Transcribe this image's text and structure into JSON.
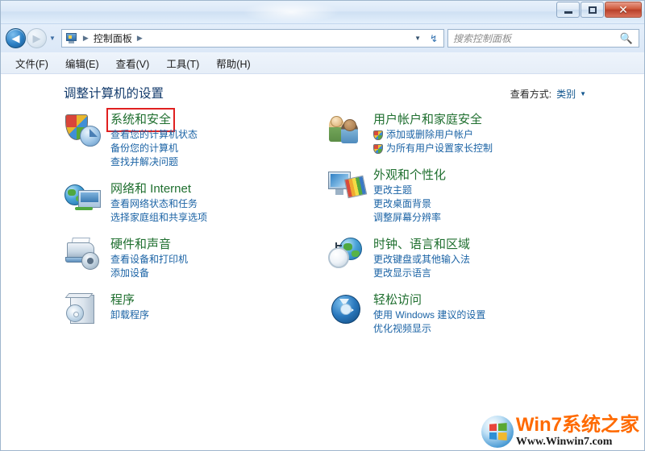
{
  "window": {
    "controls": {
      "minimize_label": "—",
      "maximize_label": "▫",
      "close_label": "✕"
    }
  },
  "addressbar": {
    "back_arrow": "◀",
    "forward_arrow": "▶",
    "history_caret": "▼",
    "breadcrumb_icon": "control-panel-icon",
    "breadcrumb": [
      "控制面板"
    ],
    "separator": "▶",
    "dropdown_caret": "▼",
    "refresh_glyph": "↯"
  },
  "search": {
    "placeholder": "搜索控制面板",
    "icon": "🔍"
  },
  "menubar": {
    "items": [
      {
        "label": "文件(F)"
      },
      {
        "label": "编辑(E)"
      },
      {
        "label": "查看(V)"
      },
      {
        "label": "工具(T)"
      },
      {
        "label": "帮助(H)"
      }
    ]
  },
  "page": {
    "title": "调整计算机的设置",
    "viewby_label": "查看方式:",
    "viewby_value": "类别",
    "viewby_caret": "▼"
  },
  "categories": {
    "left": [
      {
        "icon": "system-security-icon",
        "title": "系统和安全",
        "highlighted": true,
        "links": [
          {
            "label": "查看您的计算机状态",
            "shield": false
          },
          {
            "label": "备份您的计算机",
            "shield": false
          },
          {
            "label": "查找并解决问题",
            "shield": false
          }
        ]
      },
      {
        "icon": "network-internet-icon",
        "title": "网络和 Internet",
        "highlighted": false,
        "links": [
          {
            "label": "查看网络状态和任务",
            "shield": false
          },
          {
            "label": "选择家庭组和共享选项",
            "shield": false
          }
        ]
      },
      {
        "icon": "hardware-sound-icon",
        "title": "硬件和声音",
        "highlighted": false,
        "links": [
          {
            "label": "查看设备和打印机",
            "shield": false
          },
          {
            "label": "添加设备",
            "shield": false
          }
        ]
      },
      {
        "icon": "programs-icon",
        "title": "程序",
        "highlighted": false,
        "links": [
          {
            "label": "卸载程序",
            "shield": false
          }
        ]
      }
    ],
    "right": [
      {
        "icon": "user-accounts-icon",
        "title": "用户帐户和家庭安全",
        "highlighted": false,
        "links": [
          {
            "label": "添加或删除用户帐户",
            "shield": true
          },
          {
            "label": "为所有用户设置家长控制",
            "shield": true
          }
        ]
      },
      {
        "icon": "appearance-personalization-icon",
        "title": "外观和个性化",
        "highlighted": false,
        "links": [
          {
            "label": "更改主题",
            "shield": false
          },
          {
            "label": "更改桌面背景",
            "shield": false
          },
          {
            "label": "调整屏幕分辨率",
            "shield": false
          }
        ]
      },
      {
        "icon": "clock-language-region-icon",
        "title": "时钟、语言和区域",
        "highlighted": false,
        "links": [
          {
            "label": "更改键盘或其他输入法",
            "shield": false
          },
          {
            "label": "更改显示语言",
            "shield": false
          }
        ]
      },
      {
        "icon": "ease-of-access-icon",
        "title": "轻松访问",
        "highlighted": false,
        "links": [
          {
            "label": "使用 Windows 建议的设置",
            "shield": false
          },
          {
            "label": "优化视频显示",
            "shield": false
          }
        ]
      }
    ]
  },
  "watermark": {
    "main": "Win7系统之家",
    "sub": "Www.Winwin7.com"
  },
  "colors": {
    "category_title": "#1f6f2f",
    "link": "#1b63a5",
    "page_title": "#123a6b",
    "highlight_box": "#e02020",
    "watermark_orange": "#ff6a00"
  }
}
